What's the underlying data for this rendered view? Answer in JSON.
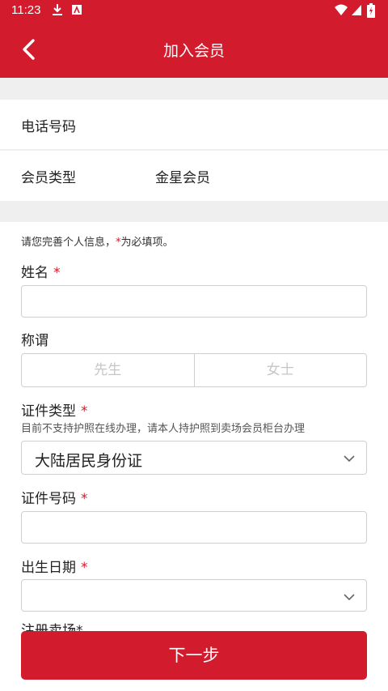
{
  "status_bar": {
    "time": "11:23"
  },
  "header": {
    "title": "加入会员"
  },
  "info": {
    "phone_label": "电话号码",
    "phone_value": "",
    "member_type_label": "会员类型",
    "member_type_value": "金星会员"
  },
  "form": {
    "hint_prefix": "请您完善个人信息，",
    "hint_star": "*",
    "hint_suffix": "为必填项。",
    "name_label": "姓名",
    "title_label": "称谓",
    "title_options": [
      "先生",
      "女士"
    ],
    "id_type_label": "证件类型",
    "id_type_note": "目前不支持护照在线办理，请本人持护照到卖场会员柜台办理",
    "id_type_value": "大陆居民身份证",
    "id_number_label": "证件号码",
    "birth_label": "出生日期",
    "store_label": "注册卖场",
    "required_mark": "*"
  },
  "footer": {
    "next_label": "下一步"
  },
  "colors": {
    "brand_red": "#d21b2c",
    "gap_gray": "#efefef"
  }
}
